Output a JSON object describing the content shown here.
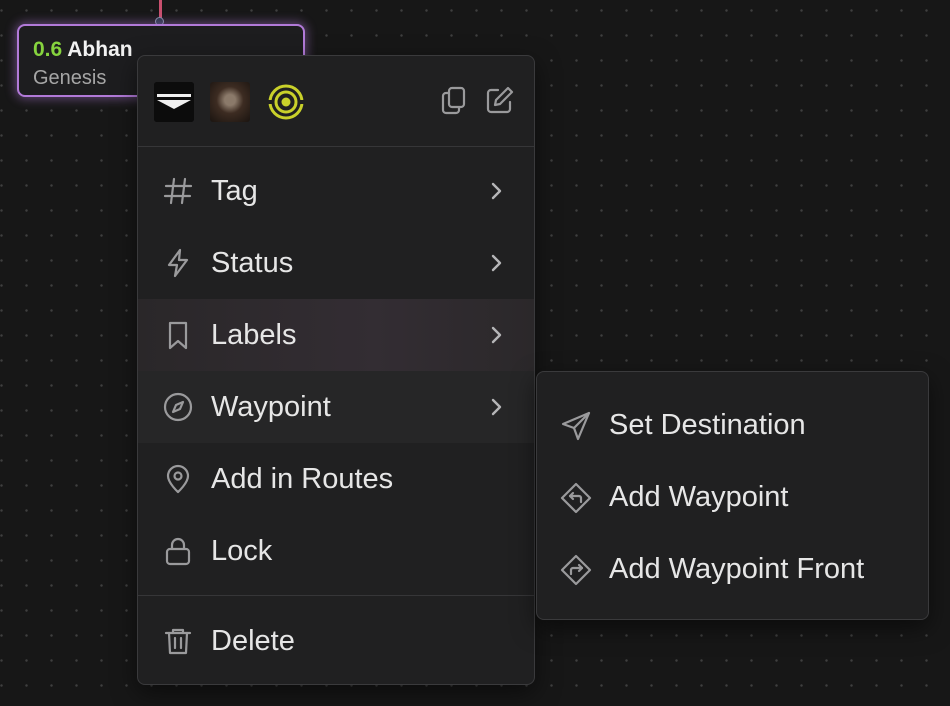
{
  "node": {
    "version": "0.6",
    "name": "Abhan",
    "subtitle": "Genesis"
  },
  "context_menu": {
    "header_icons": [
      "copy-icon",
      "edit-icon"
    ],
    "items": [
      {
        "label": "Tag",
        "icon": "hash-icon",
        "has_submenu": true
      },
      {
        "label": "Status",
        "icon": "lightning-icon",
        "has_submenu": true
      },
      {
        "label": "Labels",
        "icon": "bookmark-icon",
        "has_submenu": true
      },
      {
        "label": "Waypoint",
        "icon": "compass-icon",
        "has_submenu": true
      },
      {
        "label": "Add in Routes",
        "icon": "map-pin-icon",
        "has_submenu": false
      },
      {
        "label": "Lock",
        "icon": "lock-icon",
        "has_submenu": false
      },
      {
        "label": "Delete",
        "icon": "trash-icon",
        "has_submenu": false
      }
    ]
  },
  "waypoint_submenu": {
    "items": [
      {
        "label": "Set Destination",
        "icon": "send-icon"
      },
      {
        "label": "Add Waypoint",
        "icon": "turn-left-sign-icon"
      },
      {
        "label": "Add Waypoint Front",
        "icon": "turn-right-sign-icon"
      }
    ]
  },
  "colors": {
    "canvas_bg": "#171717",
    "node_border": "#b27ad9",
    "version_green": "#86d33e",
    "menu_bg": "#202021",
    "connector": "#c9506e"
  }
}
